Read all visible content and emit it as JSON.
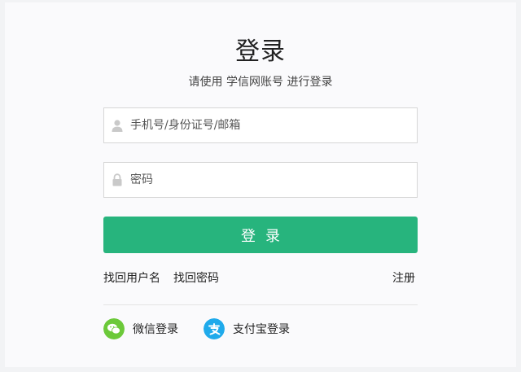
{
  "page": {
    "title": "登录",
    "subtitle": "请使用 学信网账号 进行登录"
  },
  "form": {
    "username_placeholder": "手机号/身份证号/邮箱",
    "username_value": "",
    "password_placeholder": "密码",
    "password_value": "",
    "login_label": "登录"
  },
  "links": {
    "find_username": "找回用户名",
    "find_password": "找回密码",
    "register": "注册"
  },
  "social": {
    "wechat_label": "微信登录",
    "alipay_label": "支付宝登录"
  },
  "colors": {
    "primary": "#27b47d",
    "wechat": "#6cc93a",
    "alipay": "#1faaeb"
  },
  "icons": {
    "username": "user-icon",
    "password": "lock-icon",
    "wechat": "wechat-icon",
    "alipay": "alipay-icon"
  }
}
